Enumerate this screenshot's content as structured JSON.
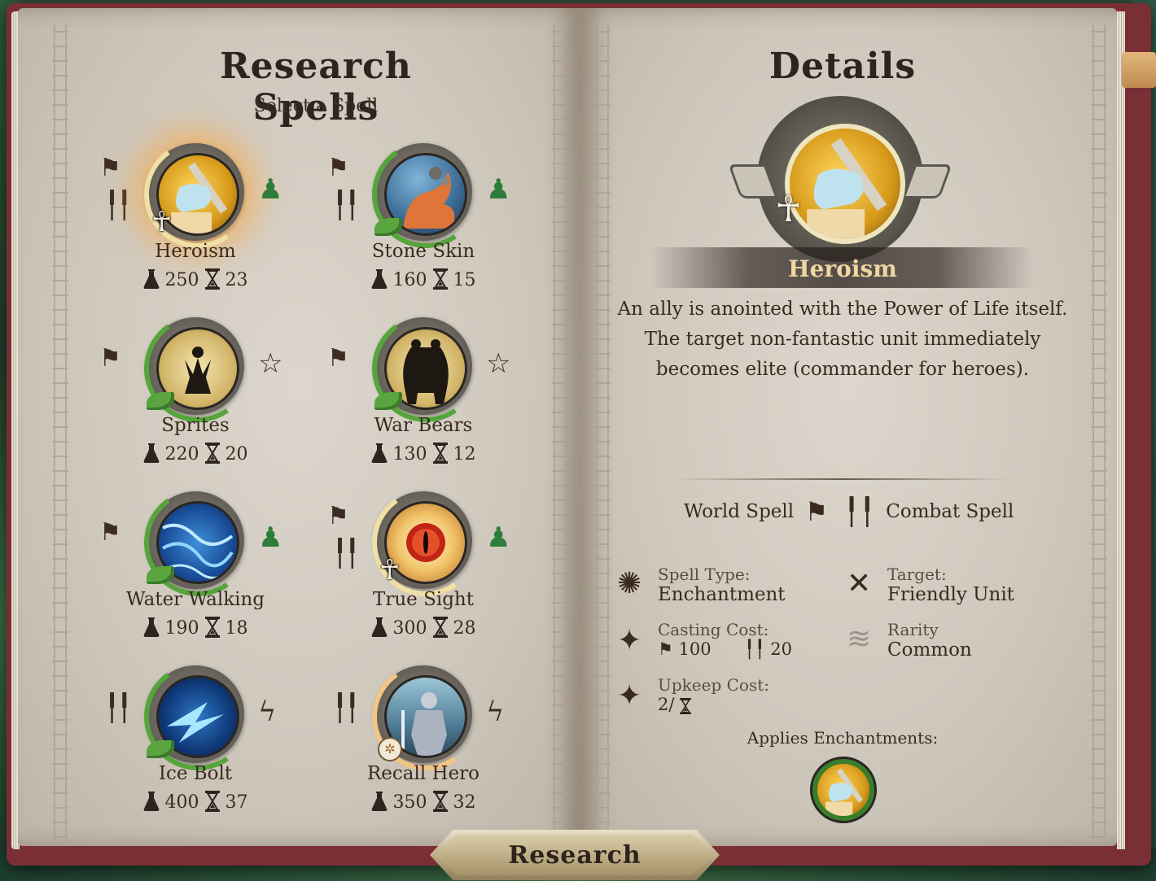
{
  "left_page": {
    "title": "Research Spells",
    "subtitle": "Select a Spell"
  },
  "spells": [
    {
      "name": "Heroism",
      "research_cost": "250",
      "turns": "23",
      "selected": true
    },
    {
      "name": "Stone Skin",
      "research_cost": "160",
      "turns": "15"
    },
    {
      "name": "Sprites",
      "research_cost": "220",
      "turns": "20"
    },
    {
      "name": "War Bears",
      "research_cost": "130",
      "turns": "12"
    },
    {
      "name": "Water Walking",
      "research_cost": "190",
      "turns": "18"
    },
    {
      "name": "True Sight",
      "research_cost": "300",
      "turns": "28"
    },
    {
      "name": "Ice Bolt",
      "research_cost": "400",
      "turns": "37"
    },
    {
      "name": "Recall Hero",
      "research_cost": "350",
      "turns": "32"
    }
  ],
  "details": {
    "title": "Details",
    "spell_name": "Heroism",
    "description": "An ally is anointed with the Power of Life itself. The target non-fantastic unit immediately becomes elite (commander for heroes).",
    "world_spell_label": "World Spell",
    "combat_spell_label": "Combat Spell",
    "spell_type_label": "Spell Type:",
    "spell_type_value": "Enchantment",
    "target_label": "Target:",
    "target_value": "Friendly Unit",
    "casting_cost_label": "Casting Cost:",
    "casting_cost_world": "100",
    "casting_cost_combat": "20",
    "rarity_label": "Rarity",
    "rarity_value": "Common",
    "upkeep_label": "Upkeep Cost:",
    "upkeep_value": "2/",
    "applies_label": "Applies Enchantments:"
  },
  "research_button": "Research",
  "colors": {
    "nature_ring": "#56a53c",
    "selected_glow": "#ffa028",
    "cover": "#7a2f35",
    "parchment": "#d6cfc4"
  }
}
